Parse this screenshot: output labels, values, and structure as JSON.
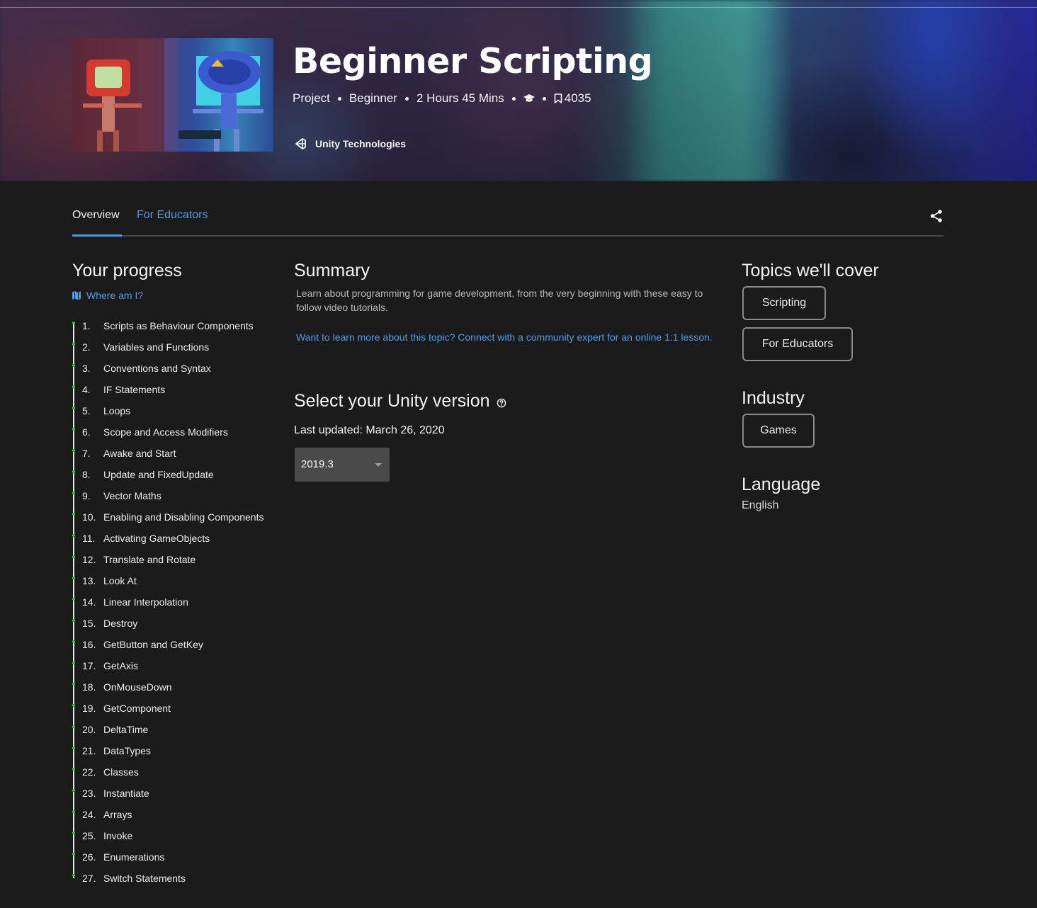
{
  "hero": {
    "title": "Beginner Scripting",
    "meta": {
      "type": "Project",
      "level": "Beginner",
      "duration": "2 Hours 45 Mins",
      "saves": "4035"
    },
    "author": "Unity Technologies"
  },
  "tabs": [
    {
      "label": "Overview",
      "active": true
    },
    {
      "label": "For Educators",
      "active": false
    }
  ],
  "progress": {
    "title": "Your progress",
    "where_link": "Where am I?",
    "lessons": [
      {
        "num": "1.",
        "name": "Scripts as Behaviour Components"
      },
      {
        "num": "2.",
        "name": "Variables and Functions"
      },
      {
        "num": "3.",
        "name": "Conventions and Syntax"
      },
      {
        "num": "4.",
        "name": "IF Statements"
      },
      {
        "num": "5.",
        "name": "Loops"
      },
      {
        "num": "6.",
        "name": "Scope and Access Modifiers"
      },
      {
        "num": "7.",
        "name": "Awake and Start"
      },
      {
        "num": "8.",
        "name": "Update and FixedUpdate"
      },
      {
        "num": "9.",
        "name": "Vector Maths"
      },
      {
        "num": "10.",
        "name": "Enabling and Disabling Components"
      },
      {
        "num": "11.",
        "name": "Activating GameObjects"
      },
      {
        "num": "12.",
        "name": "Translate and Rotate"
      },
      {
        "num": "13.",
        "name": "Look At"
      },
      {
        "num": "14.",
        "name": "Linear Interpolation"
      },
      {
        "num": "15.",
        "name": "Destroy"
      },
      {
        "num": "16.",
        "name": "GetButton and GetKey"
      },
      {
        "num": "17.",
        "name": "GetAxis"
      },
      {
        "num": "18.",
        "name": "OnMouseDown"
      },
      {
        "num": "19.",
        "name": "GetComponent"
      },
      {
        "num": "20.",
        "name": "DeltaTime"
      },
      {
        "num": "21.",
        "name": "DataTypes"
      },
      {
        "num": "22.",
        "name": "Classes"
      },
      {
        "num": "23.",
        "name": "Instantiate"
      },
      {
        "num": "24.",
        "name": "Arrays"
      },
      {
        "num": "25.",
        "name": "Invoke"
      },
      {
        "num": "26.",
        "name": "Enumerations"
      },
      {
        "num": "27.",
        "name": "Switch Statements"
      }
    ]
  },
  "summary": {
    "title": "Summary",
    "text": "Learn about programming for game development, from the very beginning with these easy to follow video tutorials.",
    "link": "Want to learn more about this topic? Connect with a community expert for an online 1:1 lesson."
  },
  "version": {
    "title": "Select your Unity version",
    "last_updated": "Last updated: March 26, 2020",
    "selected": "2019.3"
  },
  "topics": {
    "title": "Topics we'll cover",
    "items": [
      "Scripting",
      "For Educators"
    ]
  },
  "industry": {
    "title": "Industry",
    "items": [
      "Games"
    ]
  },
  "language": {
    "title": "Language",
    "value": "English"
  },
  "colors": {
    "background": "#1b1b1b",
    "link_blue": "#4c9be8",
    "progress_green": "#3fbf3f"
  },
  "icons": [
    "graduation-cap-icon",
    "bookmark-icon",
    "unity-logo-icon",
    "share-icon",
    "map-icon",
    "help-circle-icon",
    "caret-down-icon"
  ]
}
